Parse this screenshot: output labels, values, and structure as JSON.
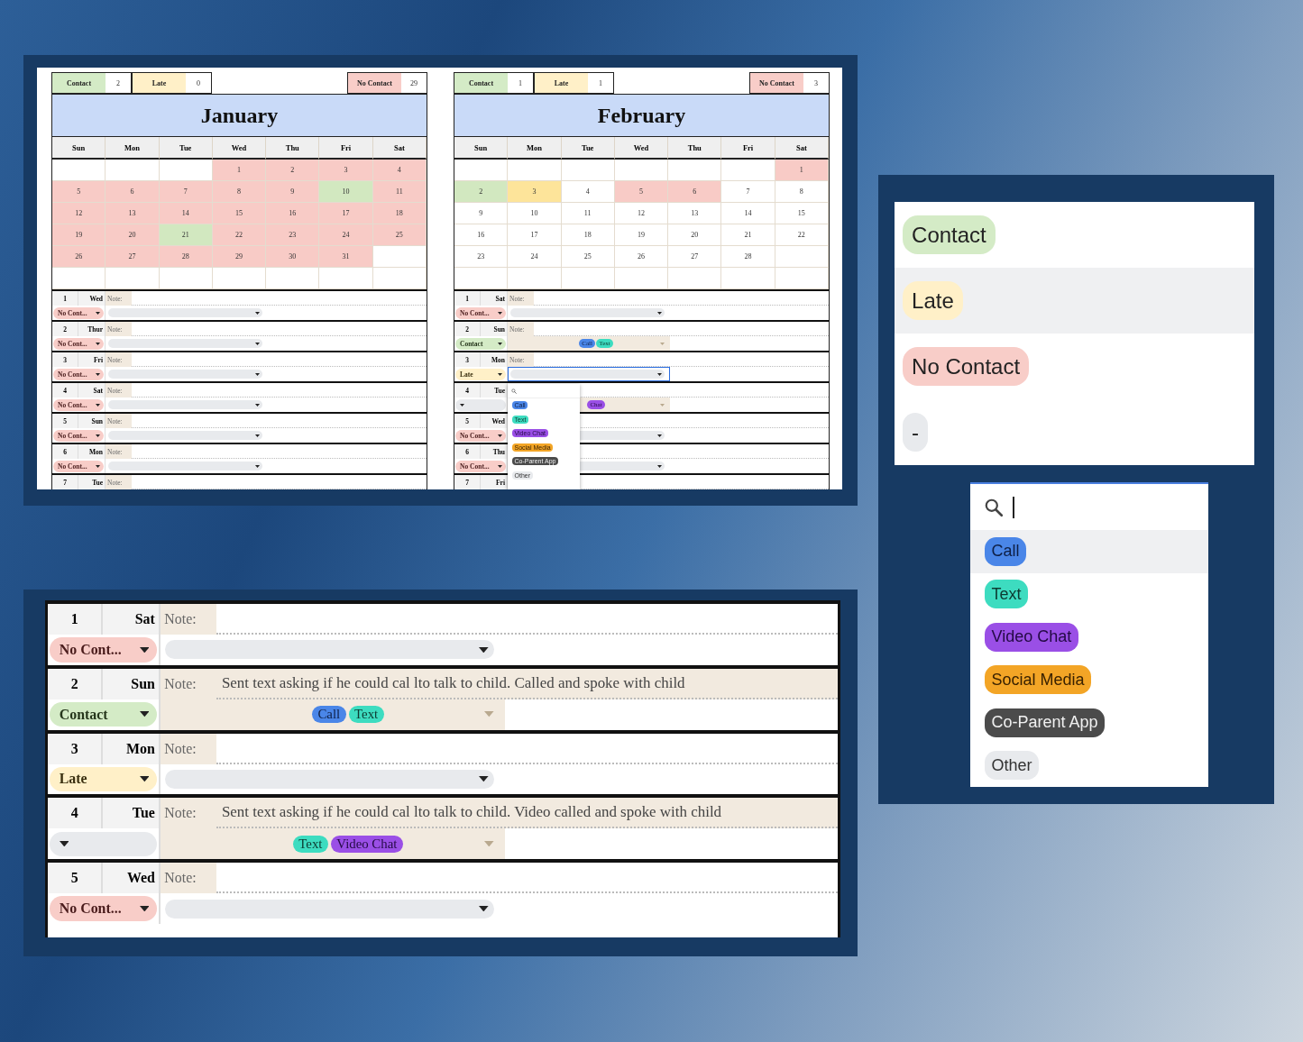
{
  "months": [
    {
      "name": "January",
      "summary": [
        {
          "label": "Contact",
          "kind": "contact",
          "count": "2"
        },
        {
          "label": "Late",
          "kind": "late",
          "count": "0"
        },
        {
          "label": "No Contact",
          "kind": "no_contact",
          "count": "29"
        }
      ],
      "weekdays": [
        "Sun",
        "Mon",
        "Tue",
        "Wed",
        "Thu",
        "Fri",
        "Sat"
      ],
      "weeks": [
        [
          {
            "kind": "blank"
          },
          {
            "kind": "blank"
          },
          {
            "kind": "blank"
          },
          {
            "day": "1",
            "kind": "no_contact"
          },
          {
            "day": "2",
            "kind": "no_contact"
          },
          {
            "day": "3",
            "kind": "no_contact"
          },
          {
            "day": "4",
            "kind": "no_contact"
          }
        ],
        [
          {
            "day": "5",
            "kind": "no_contact"
          },
          {
            "day": "6",
            "kind": "no_contact"
          },
          {
            "day": "7",
            "kind": "no_contact"
          },
          {
            "day": "8",
            "kind": "no_contact"
          },
          {
            "day": "9",
            "kind": "no_contact"
          },
          {
            "day": "10",
            "kind": "contact"
          },
          {
            "day": "11",
            "kind": "no_contact"
          }
        ],
        [
          {
            "day": "12",
            "kind": "no_contact"
          },
          {
            "day": "13",
            "kind": "no_contact"
          },
          {
            "day": "14",
            "kind": "no_contact"
          },
          {
            "day": "15",
            "kind": "no_contact"
          },
          {
            "day": "16",
            "kind": "no_contact"
          },
          {
            "day": "17",
            "kind": "no_contact"
          },
          {
            "day": "18",
            "kind": "no_contact"
          }
        ],
        [
          {
            "day": "19",
            "kind": "no_contact"
          },
          {
            "day": "20",
            "kind": "no_contact"
          },
          {
            "day": "21",
            "kind": "contact"
          },
          {
            "day": "22",
            "kind": "no_contact"
          },
          {
            "day": "23",
            "kind": "no_contact"
          },
          {
            "day": "24",
            "kind": "no_contact"
          },
          {
            "day": "25",
            "kind": "no_contact"
          }
        ],
        [
          {
            "day": "26",
            "kind": "no_contact"
          },
          {
            "day": "27",
            "kind": "no_contact"
          },
          {
            "day": "28",
            "kind": "no_contact"
          },
          {
            "day": "29",
            "kind": "no_contact"
          },
          {
            "day": "30",
            "kind": "no_contact"
          },
          {
            "day": "31",
            "kind": "no_contact"
          },
          {
            "kind": "blank"
          }
        ],
        [
          {
            "kind": "blank"
          },
          {
            "kind": "blank"
          },
          {
            "kind": "blank"
          },
          {
            "kind": "blank"
          },
          {
            "kind": "blank"
          },
          {
            "kind": "blank"
          },
          {
            "kind": "blank"
          }
        ]
      ],
      "entries": [
        {
          "date": "1",
          "weekday": "Wed",
          "note_label": "Note:",
          "status": {
            "label": "No Cont...",
            "kind": "no_contact"
          }
        },
        {
          "date": "2",
          "weekday": "Thur",
          "note_label": "Note:",
          "status": {
            "label": "No Cont...",
            "kind": "no_contact"
          }
        },
        {
          "date": "3",
          "weekday": "Fri",
          "note_label": "Note:",
          "status": {
            "label": "No Cont...",
            "kind": "no_contact"
          }
        },
        {
          "date": "4",
          "weekday": "Sat",
          "note_label": "Note:",
          "status": {
            "label": "No Cont...",
            "kind": "no_contact"
          }
        },
        {
          "date": "5",
          "weekday": "Sun",
          "note_label": "Note:",
          "status": {
            "label": "No Cont...",
            "kind": "no_contact"
          }
        },
        {
          "date": "6",
          "weekday": "Mon",
          "note_label": "Note:",
          "status": {
            "label": "No Cont...",
            "kind": "no_contact"
          }
        },
        {
          "date": "7",
          "weekday": "Tue",
          "note_label": "Note:"
        }
      ]
    },
    {
      "name": "February",
      "summary": [
        {
          "label": "Contact",
          "kind": "contact",
          "count": "1"
        },
        {
          "label": "Late",
          "kind": "late",
          "count": "1"
        },
        {
          "label": "No Contact",
          "kind": "no_contact",
          "count": "3"
        }
      ],
      "weekdays": [
        "Sun",
        "Mon",
        "Tue",
        "Wed",
        "Thu",
        "Fri",
        "Sat"
      ],
      "weeks": [
        [
          {
            "kind": "blank"
          },
          {
            "kind": "blank"
          },
          {
            "kind": "blank"
          },
          {
            "kind": "blank"
          },
          {
            "kind": "blank"
          },
          {
            "kind": "blank"
          },
          {
            "day": "1",
            "kind": "no_contact"
          }
        ],
        [
          {
            "day": "2",
            "kind": "contact"
          },
          {
            "day": "3",
            "kind": "late"
          },
          {
            "day": "4",
            "kind": "none"
          },
          {
            "day": "5",
            "kind": "no_contact"
          },
          {
            "day": "6",
            "kind": "no_contact"
          },
          {
            "day": "7",
            "kind": "none"
          },
          {
            "day": "8",
            "kind": "none"
          }
        ],
        [
          {
            "day": "9",
            "kind": "none"
          },
          {
            "day": "10",
            "kind": "none"
          },
          {
            "day": "11",
            "kind": "none"
          },
          {
            "day": "12",
            "kind": "none"
          },
          {
            "day": "13",
            "kind": "none"
          },
          {
            "day": "14",
            "kind": "none"
          },
          {
            "day": "15",
            "kind": "none"
          }
        ],
        [
          {
            "day": "16",
            "kind": "none"
          },
          {
            "day": "17",
            "kind": "none"
          },
          {
            "day": "18",
            "kind": "none"
          },
          {
            "day": "19",
            "kind": "none"
          },
          {
            "day": "20",
            "kind": "none"
          },
          {
            "day": "21",
            "kind": "none"
          },
          {
            "day": "22",
            "kind": "none"
          }
        ],
        [
          {
            "day": "23",
            "kind": "none"
          },
          {
            "day": "24",
            "kind": "none"
          },
          {
            "day": "25",
            "kind": "none"
          },
          {
            "day": "26",
            "kind": "none"
          },
          {
            "day": "27",
            "kind": "none"
          },
          {
            "day": "28",
            "kind": "none"
          },
          {
            "kind": "blank"
          }
        ],
        [
          {
            "kind": "blank"
          },
          {
            "kind": "blank"
          },
          {
            "kind": "blank"
          },
          {
            "kind": "blank"
          },
          {
            "kind": "blank"
          },
          {
            "kind": "blank"
          },
          {
            "kind": "blank"
          }
        ]
      ],
      "entries": [
        {
          "date": "1",
          "weekday": "Sat",
          "note_label": "Note:",
          "status": {
            "label": "No Cont...",
            "kind": "no_contact"
          }
        },
        {
          "date": "2",
          "weekday": "Sun",
          "note_label": "Note:",
          "status": {
            "label": "Contact",
            "kind": "contact"
          },
          "methods": [
            {
              "label": "Call",
              "kind": "call"
            },
            {
              "label": "Text",
              "kind": "text"
            }
          ]
        },
        {
          "date": "3",
          "weekday": "Mon",
          "note_label": "Note:",
          "status": {
            "label": "Late",
            "kind": "late"
          },
          "focused": true
        },
        {
          "date": "4",
          "weekday": "Tue",
          "status": {
            "kind": "none"
          },
          "methods": [
            {
              "label": "Chat",
              "kind": "video"
            }
          ]
        },
        {
          "date": "5",
          "weekday": "Wed",
          "status": {
            "label": "No Cont...",
            "kind": "no_contact"
          }
        },
        {
          "date": "6",
          "weekday": "Thu",
          "status": {
            "label": "No Cont...",
            "kind": "no_contact"
          }
        },
        {
          "date": "7",
          "weekday": "Fri"
        }
      ],
      "popup": {
        "options": [
          {
            "label": "Call",
            "kind": "call"
          },
          {
            "label": "Text",
            "kind": "text"
          },
          {
            "label": "Video Chat",
            "kind": "video"
          },
          {
            "label": "Social Media",
            "kind": "social"
          },
          {
            "label": "Co-Parent App",
            "kind": "coparent"
          },
          {
            "label": "Other",
            "kind": "other"
          }
        ]
      }
    }
  ],
  "zoomed_entries": [
    {
      "date": "1",
      "weekday": "Sat",
      "note_label": "Note:",
      "status": {
        "label": "No Cont...",
        "kind": "no_contact"
      }
    },
    {
      "date": "2",
      "weekday": "Sun",
      "note_label": "Note:",
      "note": "Sent text asking if he could cal lto talk to child. Called and spoke with child",
      "status": {
        "label": "Contact",
        "kind": "contact"
      },
      "methods": [
        {
          "label": "Call",
          "kind": "call"
        },
        {
          "label": "Text",
          "kind": "text"
        }
      ]
    },
    {
      "date": "3",
      "weekday": "Mon",
      "note_label": "Note:",
      "status": {
        "label": "Late",
        "kind": "late"
      }
    },
    {
      "date": "4",
      "weekday": "Tue",
      "note_label": "Note:",
      "note": "Sent text asking if he could cal lto talk to child. Video called and spoke with child",
      "status": {
        "kind": "none"
      },
      "methods": [
        {
          "label": "Text",
          "kind": "text"
        },
        {
          "label": "Video Chat",
          "kind": "video"
        }
      ]
    },
    {
      "date": "5",
      "weekday": "Wed",
      "note_label": "Note:",
      "status": {
        "label": "No Cont...",
        "kind": "no_contact"
      }
    }
  ],
  "status_menu": {
    "options": [
      {
        "label": "Contact",
        "kind": "contact",
        "highlighted": false
      },
      {
        "label": "Late",
        "kind": "late",
        "highlighted": true
      },
      {
        "label": "No Contact",
        "kind": "no_contact",
        "highlighted": false
      },
      {
        "label": "-",
        "kind": "none",
        "highlighted": false
      }
    ]
  },
  "method_menu": {
    "options": [
      {
        "label": "Call",
        "kind": "call",
        "highlighted": true
      },
      {
        "label": "Text",
        "kind": "text",
        "highlighted": false
      },
      {
        "label": "Video Chat",
        "kind": "video",
        "highlighted": false
      },
      {
        "label": "Social Media",
        "kind": "social",
        "highlighted": false
      },
      {
        "label": "Co-Parent App",
        "kind": "coparent",
        "highlighted": false
      },
      {
        "label": "Other",
        "kind": "other",
        "highlighted": false
      }
    ]
  }
}
